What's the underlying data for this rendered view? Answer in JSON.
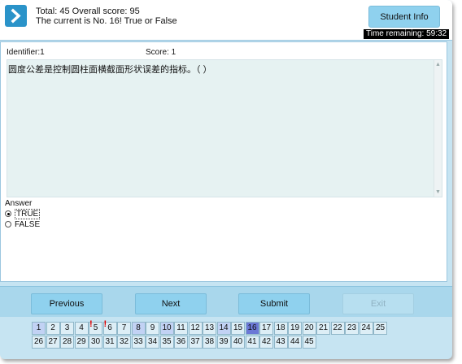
{
  "header": {
    "total_line": "Total: 45 Overall score: 95",
    "current_line": "The current is No. 16! True or False",
    "student_info_label": "Student Info",
    "time_remaining": "Time remaining: 59:32"
  },
  "question": {
    "identifier": "Identifier:1",
    "score": "Score: 1",
    "text": "圆度公差是控制圆柱面横截面形状误差的指标。（ ）",
    "answer_label": "Answer",
    "options": [
      {
        "label": "TRUE",
        "selected": true
      },
      {
        "label": "FALSE",
        "selected": false
      }
    ]
  },
  "nav": {
    "previous": "Previous",
    "next": "Next",
    "submit": "Submit",
    "exit": "Exit",
    "exit_disabled": true
  },
  "grid": {
    "numbers": [
      "1",
      "2",
      "3",
      "4",
      "5",
      "6",
      "7",
      "8",
      "9",
      "10",
      "11",
      "12",
      "13",
      "14",
      "15",
      "16",
      "17",
      "18",
      "19",
      "20",
      "21",
      "22",
      "23",
      "24",
      "25",
      "26",
      "27",
      "28",
      "29",
      "30",
      "31",
      "32",
      "33",
      "34",
      "35",
      "36",
      "37",
      "38",
      "39",
      "40",
      "41",
      "42",
      "43",
      "44",
      "45"
    ],
    "current": "16",
    "answered": [
      "1",
      "8",
      "10",
      "14"
    ],
    "flagged": [
      "5",
      "6"
    ],
    "flag_symbol": "!"
  },
  "colors": {
    "accent": "#8fd1ee",
    "logo": "#2a93c9",
    "current_cell": "#6b78d6",
    "answered_cell": "#c2d2f4",
    "flag": "#e00000"
  },
  "icons": {
    "logo": "chevron-right-icon"
  }
}
